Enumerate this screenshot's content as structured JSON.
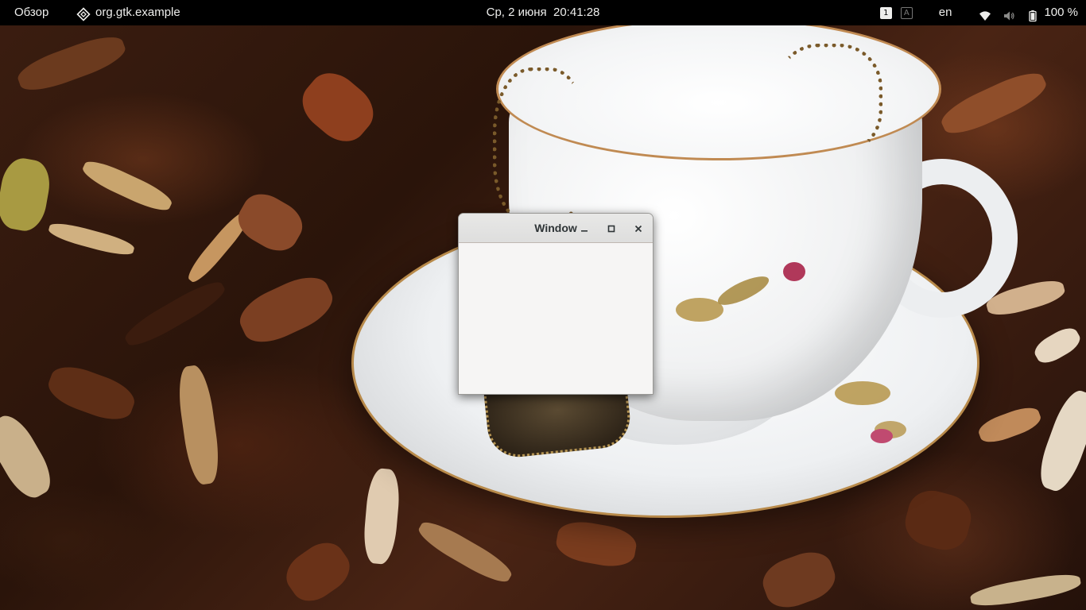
{
  "topbar": {
    "activities_label": "Обзор",
    "app_menu": {
      "icon": "application-diamond-icon",
      "label": "org.gtk.example"
    },
    "clock": "Ср, 2 июня  20:41:28",
    "workspaces": [
      {
        "label": "1",
        "active": true
      },
      {
        "label": "A",
        "active": false
      }
    ],
    "input_language": "en",
    "icons": [
      "wifi-icon",
      "volume-muted-icon",
      "battery-icon"
    ],
    "battery_percent": "100 %"
  },
  "window": {
    "title": "Window",
    "buttons": [
      "minimize-icon",
      "maximize-icon",
      "close-icon"
    ]
  },
  "colors": {
    "topbar_bg": "#000000",
    "topbar_fg": "#eeeeec",
    "window_bg": "#f6f5f4",
    "titlebar_bg": "#e1e0df"
  }
}
